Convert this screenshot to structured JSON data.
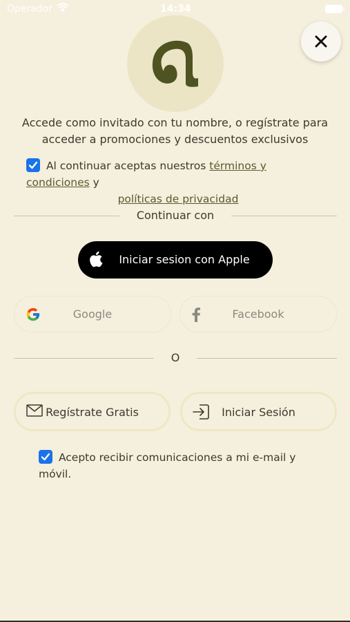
{
  "status_bar": {
    "carrier": "Operador",
    "time": "14:34"
  },
  "header": {
    "close_icon": "close-icon",
    "logo_icon": "brand-logo-g"
  },
  "intro": {
    "text": "Accede como invitado con tu nombre, o regístrate para acceder a promociones y descuentos exclusivos"
  },
  "terms": {
    "checked": true,
    "prefix": "Al continuar aceptas nuestros",
    "terms_link": "términos y condiciones",
    "connector": "y",
    "privacy_link": "políticas de privacidad"
  },
  "continue_with": {
    "label": "Continuar con"
  },
  "apple_button": {
    "label": "Iniciar sesion con Apple",
    "icon": "apple-icon"
  },
  "google_button": {
    "label": "Google",
    "icon": "google-icon"
  },
  "facebook_button": {
    "label": "Facebook",
    "icon": "facebook-icon"
  },
  "or_divider": {
    "label": "O"
  },
  "register_button": {
    "label": "Regístrate Gratis",
    "icon": "mail-icon"
  },
  "login_button": {
    "label": "Iniciar Sesión",
    "icon": "login-icon"
  },
  "consent": {
    "checked": true,
    "text": "Acepto recibir comunicaciones a mi e-mail y móvil."
  },
  "colors": {
    "background": "#f5efdd",
    "logo_bg": "#ebe5c5",
    "logo_fg": "#4f5322",
    "checkbox": "#1a73e8"
  }
}
